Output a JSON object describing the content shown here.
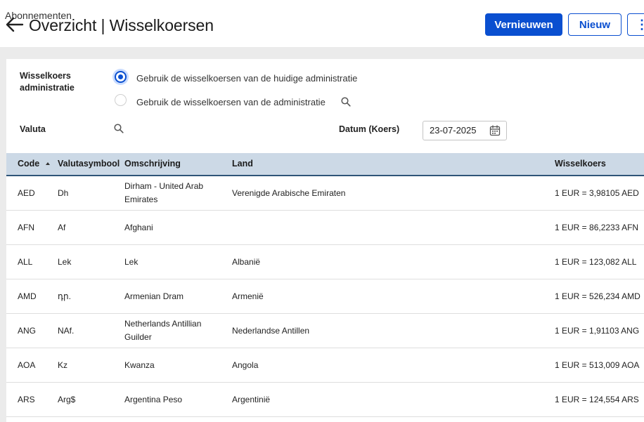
{
  "header": {
    "breadcrumb": "Abonnementen",
    "title": "Overzicht | Wisselkoersen",
    "refresh_label": "Vernieuwen",
    "new_label": "Nieuw",
    "more_label": "⋮"
  },
  "filters": {
    "admin_label": "Wisselkoers administratie",
    "option_current": "Gebruik de wisselkoersen van de huidige administratie",
    "option_other": "Gebruik de wisselkoersen van de administratie",
    "currency_label": "Valuta",
    "date_label": "Datum (Koers)",
    "date_value": "23-07-2025"
  },
  "table": {
    "headers": {
      "code": "Code",
      "symbol": "Valutasymbool",
      "description": "Omschrijving",
      "country": "Land",
      "rate": "Wisselkoers"
    },
    "rows": [
      {
        "code": "AED",
        "symbol": "Dh",
        "description": "Dirham - United Arab Emirates",
        "country": "Verenigde Arabische Emiraten",
        "rate": "1 EUR = 3,98105 AED"
      },
      {
        "code": "AFN",
        "symbol": "Af",
        "description": "Afghani",
        "country": "",
        "rate": "1 EUR = 86,2233 AFN"
      },
      {
        "code": "ALL",
        "symbol": "Lek",
        "description": "Lek",
        "country": "Albanië",
        "rate": "1 EUR = 123,082 ALL"
      },
      {
        "code": "AMD",
        "symbol": "դր.",
        "description": "Armenian Dram",
        "country": "Armenië",
        "rate": "1 EUR = 526,234 AMD"
      },
      {
        "code": "ANG",
        "symbol": "NAf.",
        "description": "Netherlands Antillian Guilder",
        "country": "Nederlandse Antillen",
        "rate": "1 EUR = 1,91103 ANG"
      },
      {
        "code": "AOA",
        "symbol": "Kz",
        "description": "Kwanza",
        "country": "Angola",
        "rate": "1 EUR = 513,009 AOA"
      },
      {
        "code": "ARS",
        "symbol": "Arg$",
        "description": "Argentina Peso",
        "country": "Argentinië",
        "rate": "1 EUR = 124,554 ARS"
      }
    ]
  }
}
